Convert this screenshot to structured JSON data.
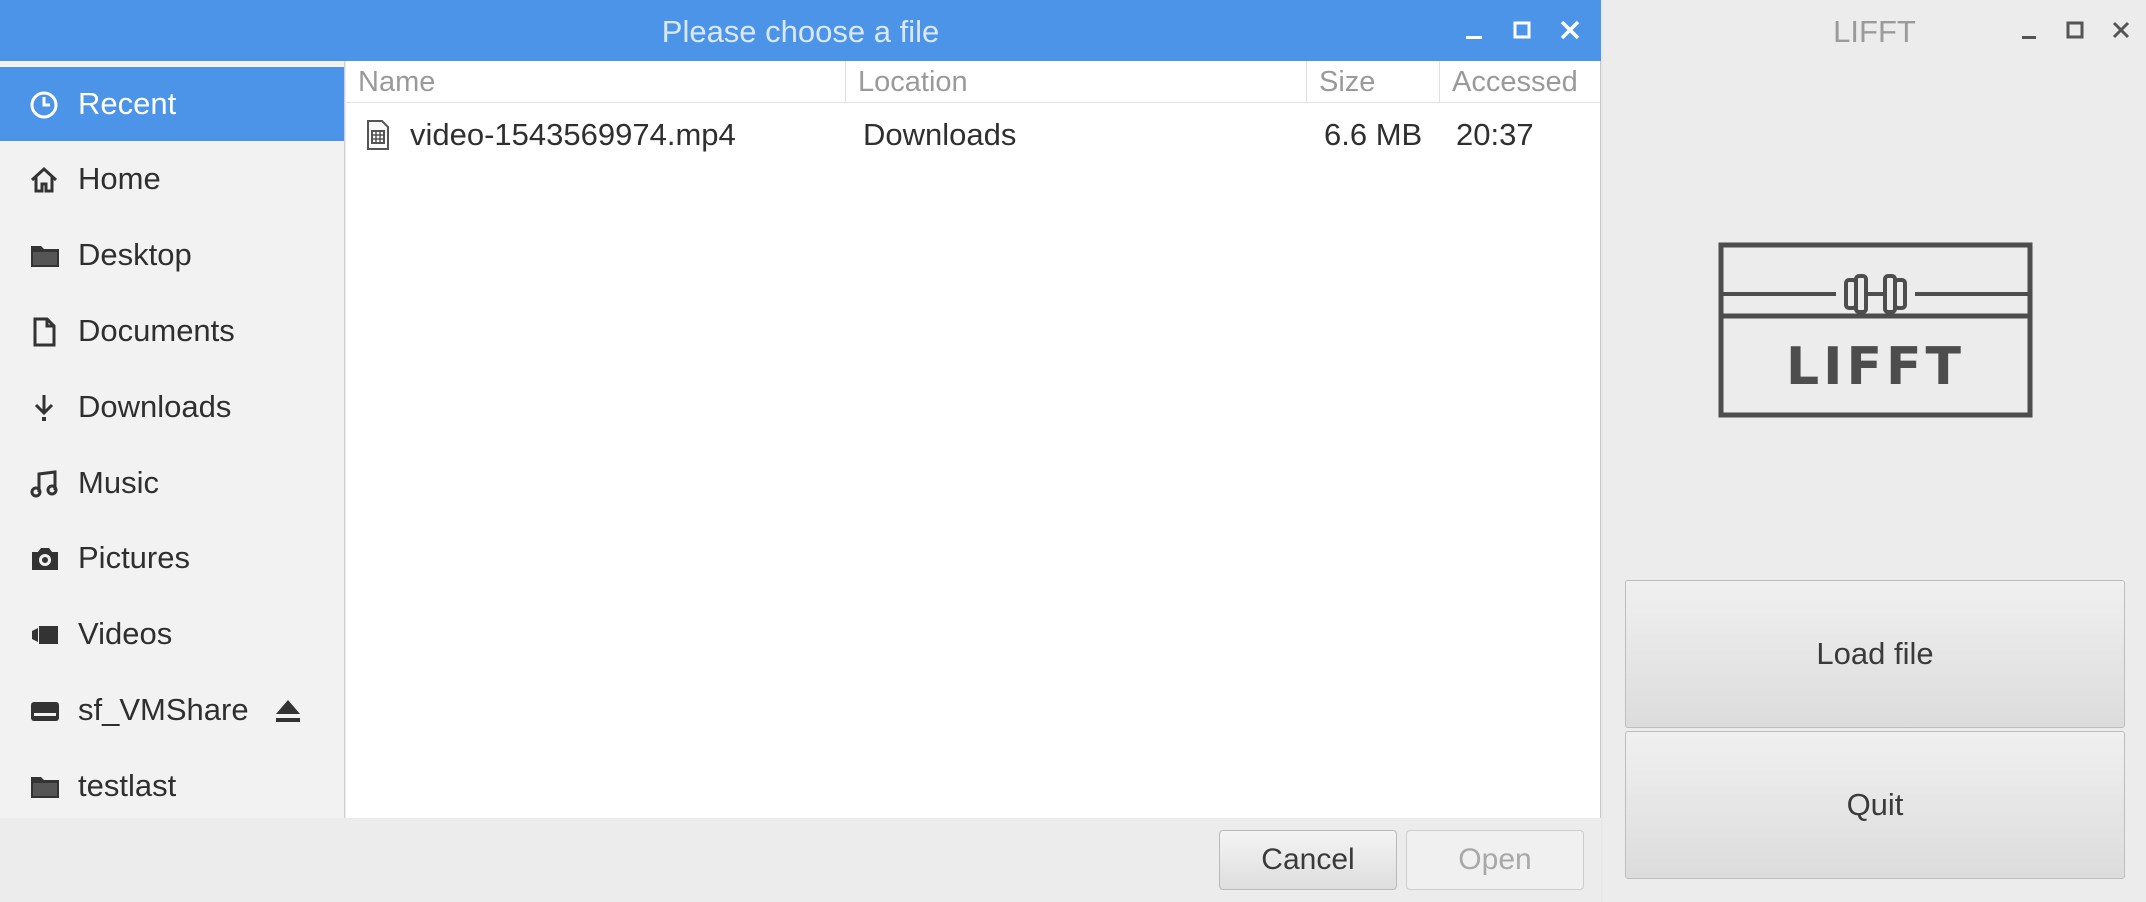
{
  "dialog": {
    "title": "Please choose a file",
    "controls": [
      "minimize-icon",
      "maximize-icon",
      "close-icon"
    ],
    "accent_color": "#4c94e8",
    "sidebar": {
      "items": [
        {
          "label": "Recent",
          "icon": "clock-icon",
          "selected": true
        },
        {
          "label": "Home",
          "icon": "home-icon"
        },
        {
          "label": "Desktop",
          "icon": "folder-icon"
        },
        {
          "label": "Documents",
          "icon": "document-icon"
        },
        {
          "label": "Downloads",
          "icon": "download-icon"
        },
        {
          "label": "Music",
          "icon": "music-icon"
        },
        {
          "label": "Pictures",
          "icon": "camera-icon"
        },
        {
          "label": "Videos",
          "icon": "video-icon"
        },
        {
          "label": "sf_VMShare",
          "icon": "drive-icon",
          "action_icon": "eject-icon"
        },
        {
          "label": "testlast",
          "icon": "folder-icon"
        }
      ]
    },
    "file_list": {
      "columns": [
        "Name",
        "Location",
        "Size",
        "Accessed"
      ],
      "rows": [
        {
          "name": "video-1543569974.mp4",
          "location": "Downloads",
          "size": "6.6 MB",
          "accessed": "20:37",
          "icon": "video-file-icon"
        }
      ]
    },
    "buttons": {
      "cancel": "Cancel",
      "open": "Open"
    }
  },
  "lifft": {
    "title": "LIFFT",
    "controls": [
      "minimize-icon",
      "maximize-icon",
      "close-icon"
    ],
    "logo": {
      "text": "LIFFT",
      "icon": "dumbbell-icon"
    },
    "buttons": {
      "load": "Load file",
      "quit": "Quit"
    }
  }
}
